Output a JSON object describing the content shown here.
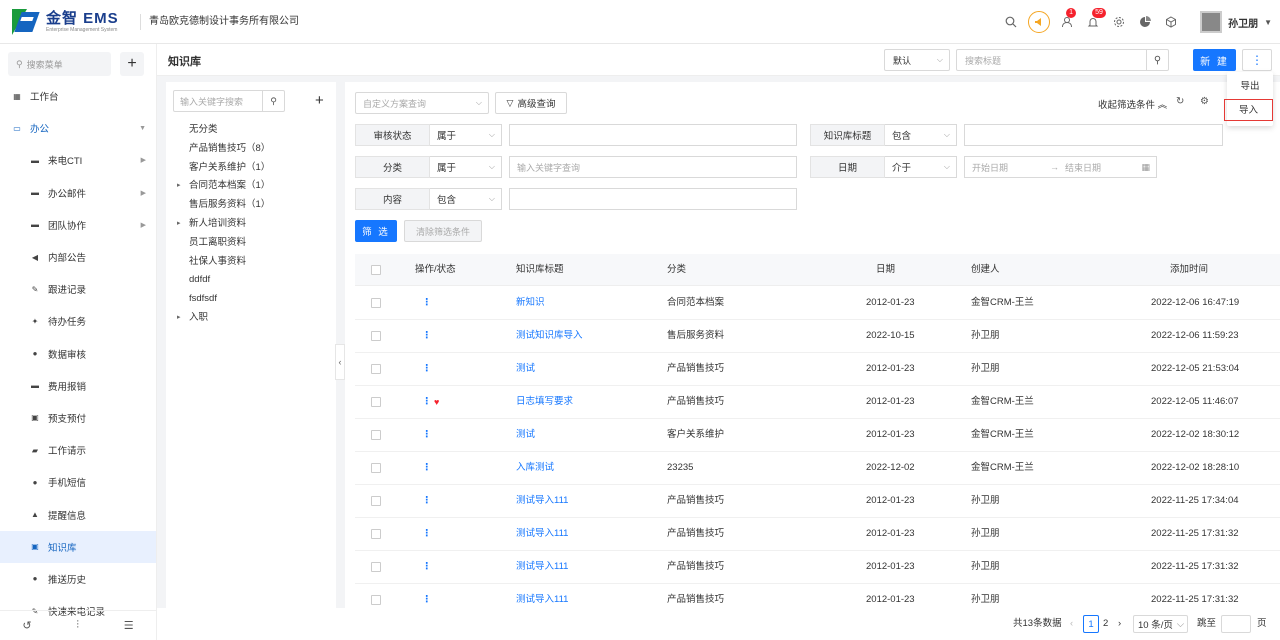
{
  "brand": {
    "name": "金智 EMS",
    "subtitle": "Enterprise Management System"
  },
  "company": "青岛欧克德制设计事务所有限公司",
  "header": {
    "badges": {
      "user_notice": "1",
      "bell": "59"
    },
    "user": "孙卫朋"
  },
  "sidebar": {
    "search_placeholder": "搜索菜单",
    "items": [
      {
        "label": "工作台",
        "icon": "dashboard-icon",
        "level": 1
      },
      {
        "label": "办公",
        "icon": "monitor-icon",
        "level": 1,
        "expanded": true
      },
      {
        "label": "来电CTI",
        "icon": "folder-icon",
        "level": 2,
        "has_children": true
      },
      {
        "label": "办公邮件",
        "icon": "folder-icon",
        "level": 2,
        "has_children": true
      },
      {
        "label": "团队协作",
        "icon": "folder-icon",
        "level": 2,
        "has_children": true
      },
      {
        "label": "内部公告",
        "icon": "speaker-icon",
        "level": 2
      },
      {
        "label": "跟进记录",
        "icon": "edit-icon",
        "level": 2
      },
      {
        "label": "待办任务",
        "icon": "pin-icon",
        "level": 2
      },
      {
        "label": "数据审核",
        "icon": "person-icon",
        "level": 2
      },
      {
        "label": "费用报销",
        "icon": "card-icon",
        "level": 2
      },
      {
        "label": "预支预付",
        "icon": "wallet-icon",
        "level": 2
      },
      {
        "label": "工作请示",
        "icon": "flag-icon",
        "level": 2
      },
      {
        "label": "手机短信",
        "icon": "chat-icon",
        "level": 2
      },
      {
        "label": "提醒信息",
        "icon": "bell-icon",
        "level": 2
      },
      {
        "label": "知识库",
        "icon": "book-icon",
        "level": 2,
        "active": true
      },
      {
        "label": "推送历史",
        "icon": "clock-icon",
        "level": 2
      },
      {
        "label": "快速来电记录",
        "icon": "edit-icon",
        "level": 2
      }
    ]
  },
  "page": {
    "title": "知识库",
    "view_select": "默认",
    "title_search_placeholder": "搜索标题",
    "new_label": "新 建",
    "more_menu": [
      "导出",
      "导入"
    ]
  },
  "tree": {
    "search_placeholder": "输入关键字搜索",
    "nodes": [
      {
        "label": "无分类",
        "expandable": false
      },
      {
        "label": "产品销售技巧（8）",
        "expandable": false
      },
      {
        "label": "客户关系维护（1）",
        "expandable": false
      },
      {
        "label": "合同范本档案（1）",
        "expandable": true
      },
      {
        "label": "售后服务资料（1）",
        "expandable": false
      },
      {
        "label": "新人培训资料",
        "expandable": true
      },
      {
        "label": "员工离职资料",
        "expandable": false
      },
      {
        "label": "社保人事资料",
        "expandable": false
      },
      {
        "label": "ddfdf",
        "expandable": false
      },
      {
        "label": "fsdfsdf",
        "expandable": false
      },
      {
        "label": "入职",
        "expandable": true
      }
    ]
  },
  "filters": {
    "scheme_placeholder": "自定义方案查询",
    "advanced_label": "高级查询",
    "collapse_label": "收起筛选条件",
    "rows": [
      {
        "label": "审核状态",
        "op": "属于",
        "value": ""
      },
      {
        "label": "知识库标题",
        "op": "包含",
        "value": ""
      },
      {
        "label": "分类",
        "op": "属于",
        "value": "输入关键字查询"
      },
      {
        "label": "日期",
        "op": "介于",
        "start": "开始日期",
        "end": "结束日期"
      },
      {
        "label": "内容",
        "op": "包含",
        "value": ""
      }
    ],
    "filter_btn": "筛 选",
    "clear_btn": "清除筛选条件"
  },
  "table": {
    "headers": [
      "操作/状态",
      "知识库标题",
      "分类",
      "日期",
      "创建人",
      "添加时间"
    ],
    "rows": [
      {
        "title": "新知识",
        "category": "合同范本档案",
        "date": "2012-01-23",
        "creator": "金智CRM-王兰",
        "added": "2022-12-06 16:47:19",
        "fav": false
      },
      {
        "title": "测试知识库导入",
        "category": "售后服务资料",
        "date": "2022-10-15",
        "creator": "孙卫朋",
        "added": "2022-12-06 11:59:23",
        "fav": false
      },
      {
        "title": "测试",
        "category": "产品销售技巧",
        "date": "2012-01-23",
        "creator": "孙卫朋",
        "added": "2022-12-05 21:53:04",
        "fav": false
      },
      {
        "title": "日志填写要求",
        "category": "产品销售技巧",
        "date": "2012-01-23",
        "creator": "金智CRM-王兰",
        "added": "2022-12-05 11:46:07",
        "fav": true
      },
      {
        "title": "测试",
        "category": "客户关系维护",
        "date": "2012-01-23",
        "creator": "金智CRM-王兰",
        "added": "2022-12-02 18:30:12",
        "fav": false
      },
      {
        "title": "入库测试",
        "category": "23235",
        "date": "2022-12-02",
        "creator": "金智CRM-王兰",
        "added": "2022-12-02 18:28:10",
        "fav": false
      },
      {
        "title": "测试导入111",
        "category": "产品销售技巧",
        "date": "2012-01-23",
        "creator": "孙卫朋",
        "added": "2022-11-25 17:34:04",
        "fav": false
      },
      {
        "title": "测试导入111",
        "category": "产品销售技巧",
        "date": "2012-01-23",
        "creator": "孙卫朋",
        "added": "2022-11-25 17:31:32",
        "fav": false
      },
      {
        "title": "测试导入111",
        "category": "产品销售技巧",
        "date": "2012-01-23",
        "creator": "孙卫朋",
        "added": "2022-11-25 17:31:32",
        "fav": false
      },
      {
        "title": "测试导入111",
        "category": "产品销售技巧",
        "date": "2012-01-23",
        "creator": "孙卫朋",
        "added": "2022-11-25 17:31:32",
        "fav": false
      }
    ]
  },
  "pager": {
    "total": "共13条数据",
    "pages": [
      "1",
      "2"
    ],
    "current": "1",
    "size": "10 条/页",
    "jump": "跳至",
    "page_unit": "页"
  },
  "colors": {
    "primary": "#1677ff",
    "brand_blue": "#1a3e8c",
    "brand_green": "#1a9b3c",
    "danger": "#f5222d"
  }
}
